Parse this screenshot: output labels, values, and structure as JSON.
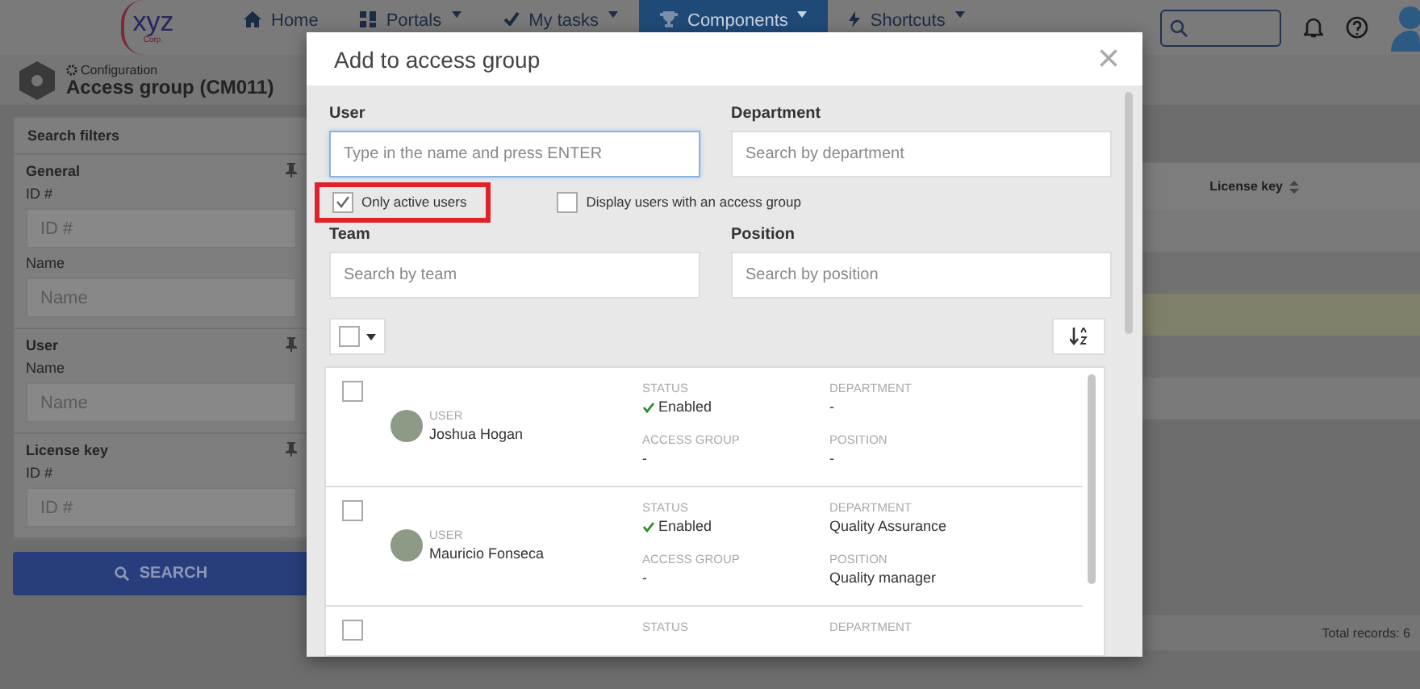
{
  "navbar": {
    "logo": "xyz",
    "logo_sub": "Corp.",
    "items": [
      {
        "kind": "home",
        "label": "Home",
        "has_menu": false,
        "selected": false
      },
      {
        "kind": "portals",
        "label": "Portals",
        "has_menu": true,
        "selected": false
      },
      {
        "kind": "tasks",
        "label": "My tasks",
        "has_menu": true,
        "selected": false
      },
      {
        "kind": "components",
        "label": "Components",
        "has_menu": true,
        "selected": true
      },
      {
        "kind": "shortcuts",
        "label": "Shortcuts",
        "has_menu": true,
        "selected": false
      }
    ]
  },
  "page_header": {
    "breadcrumb": "Configuration",
    "title": "Access group (CM011)"
  },
  "filters": {
    "title": "Search filters",
    "sections": [
      {
        "title": "General",
        "fields": [
          {
            "label": "ID #",
            "placeholder": "ID #"
          },
          {
            "label": "Name",
            "placeholder": "Name"
          }
        ]
      },
      {
        "title": "User",
        "fields": [
          {
            "label": "Name",
            "placeholder": "Name"
          }
        ]
      },
      {
        "title": "License key",
        "fields": [
          {
            "label": "ID #",
            "placeholder": "ID #"
          }
        ]
      }
    ],
    "search_button": "SEARCH"
  },
  "table": {
    "columns": [
      "License key"
    ],
    "rows": [
      {
        "selected": false
      },
      {
        "selected": false
      },
      {
        "selected": true
      },
      {
        "selected": false
      },
      {
        "selected": false
      }
    ],
    "footer": "Total records: 6"
  },
  "dialog": {
    "title": "Add to access group",
    "close": "×",
    "top_fields": [
      {
        "label": "User",
        "placeholder": "Type in the name and press ENTER",
        "focused": true
      },
      {
        "label": "Department",
        "placeholder": "Search by department",
        "focused": false
      }
    ],
    "options": [
      {
        "label": "Only active users",
        "checked": true,
        "highlighted": true
      },
      {
        "label": "Display users with an access group",
        "checked": false,
        "highlighted": false
      }
    ],
    "bottom_fields": [
      {
        "label": "Team",
        "placeholder": "Search by team",
        "focused": false
      },
      {
        "label": "Position",
        "placeholder": "Search by position",
        "focused": false
      }
    ],
    "users": [
      {
        "checked": false,
        "user_label": "USER",
        "name": "Joshua Hogan",
        "status_label": "STATUS",
        "status": "Enabled",
        "enabled": true,
        "access_group_label": "ACCESS GROUP",
        "access_group": "-",
        "department_label": "DEPARTMENT",
        "department": "-",
        "position_label": "POSITION",
        "position": "-"
      },
      {
        "checked": false,
        "user_label": "USER",
        "name": "Mauricio Fonseca",
        "status_label": "STATUS",
        "status": "Enabled",
        "enabled": true,
        "access_group_label": "ACCESS GROUP",
        "access_group": "-",
        "department_label": "DEPARTMENT",
        "department": "Quality Assurance",
        "position_label": "POSITION",
        "position": "Quality manager"
      },
      {
        "checked": false,
        "status_label": "STATUS",
        "department_label": "DEPARTMENT"
      }
    ]
  }
}
